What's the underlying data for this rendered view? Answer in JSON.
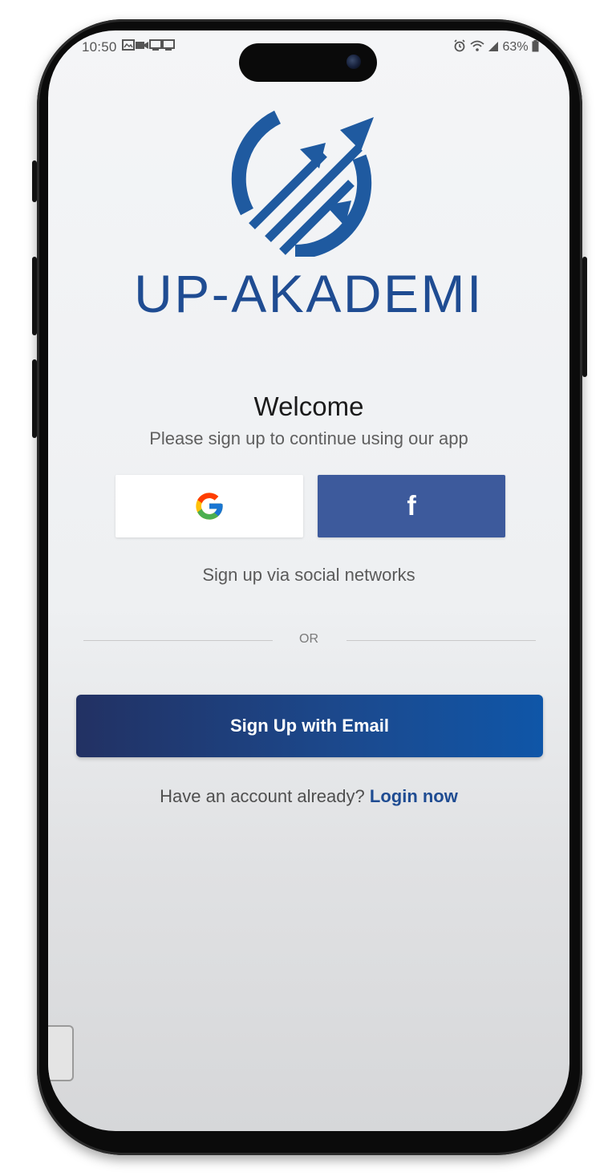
{
  "status_bar": {
    "time": "10:50",
    "battery": "63%"
  },
  "brand": {
    "name": "UP-AKADEMI",
    "color": "#1f4c92"
  },
  "welcome": {
    "title": "Welcome",
    "subtitle": "Please sign up to continue using our app"
  },
  "social": {
    "google_icon": "google-g-icon",
    "facebook_label": "f",
    "facebook_color": "#3d5a9c",
    "note": "Sign up via social networks"
  },
  "divider": {
    "label": "OR"
  },
  "email_signup": {
    "label": "Sign Up with Email"
  },
  "login": {
    "prompt": "Have an account already?",
    "link_label": "Login now"
  }
}
